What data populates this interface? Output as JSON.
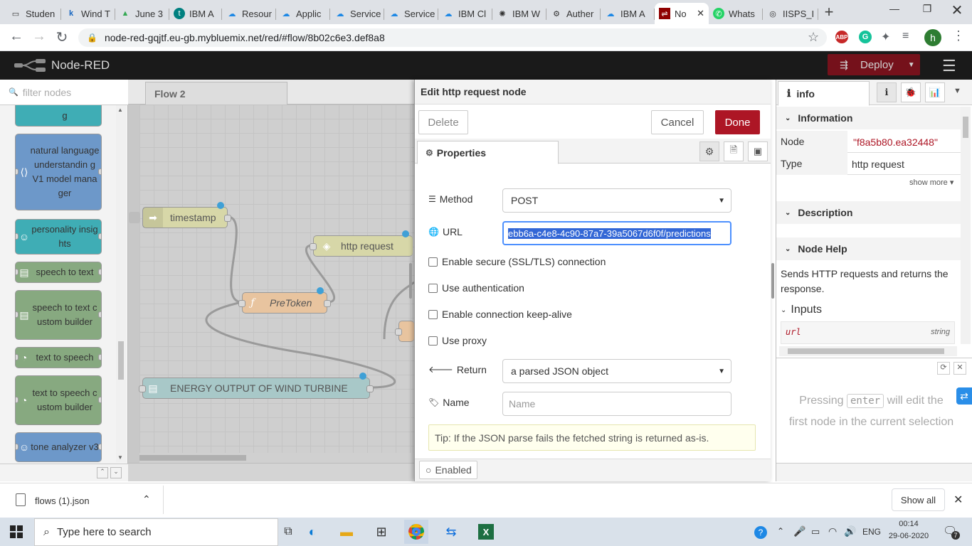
{
  "browser": {
    "tabs": [
      {
        "label": "Studen",
        "icon": "doc-icon"
      },
      {
        "label": "Wind T",
        "icon": "k-icon"
      },
      {
        "label": "June 3",
        "icon": "drive-icon"
      },
      {
        "label": "IBM A",
        "icon": "t-icon"
      },
      {
        "label": "Resour",
        "icon": "cloud-icon"
      },
      {
        "label": "Applic",
        "icon": "cloud-icon"
      },
      {
        "label": "Service",
        "icon": "cloud-icon"
      },
      {
        "label": "Service",
        "icon": "cloud-icon"
      },
      {
        "label": "IBM Cl",
        "icon": "cloud-icon"
      },
      {
        "label": "IBM W",
        "icon": "watson-icon"
      },
      {
        "label": "Auther",
        "icon": "auth-icon"
      },
      {
        "label": "IBM A",
        "icon": "cloud-icon"
      },
      {
        "label": "No",
        "icon": "nodered-icon",
        "active": true
      },
      {
        "label": "Whats",
        "icon": "whatsapp-icon"
      },
      {
        "label": "IISPS_I",
        "icon": "globe-icon"
      }
    ],
    "url": "node-red-gqjtf.eu-gb.mybluemix.net/red/#flow/8b02c6e3.def8a8",
    "profile_initial": "h",
    "new_tab": "+"
  },
  "nodered": {
    "app_title": "Node-RED",
    "deploy_label": "Deploy",
    "palette": {
      "filter_placeholder": "filter nodes",
      "nodes": [
        {
          "label": "g",
          "color": "#3FADB5"
        },
        {
          "label": "natural language understandin g V1 model manager",
          "color": "#6d98c9"
        },
        {
          "label": "personality insights",
          "color": "#3FADB5"
        },
        {
          "label": "speech to text",
          "color": "#87a980"
        },
        {
          "label": "speech to text custom builder",
          "color": "#87a980"
        },
        {
          "label": "text to speech",
          "color": "#87a980"
        },
        {
          "label": "text to speech custom builder",
          "color": "#87a980"
        },
        {
          "label": "tone analyzer v3",
          "color": "#6d98c9"
        }
      ]
    },
    "workspace": {
      "tab_label": "Flow 2",
      "nodes": {
        "timestamp": "timestamp",
        "http_request": "http request",
        "pretoken": "PreToken",
        "energy": "ENERGY OUTPUT OF WIND TURBINE"
      }
    },
    "editor": {
      "title": "Edit http request node",
      "delete_label": "Delete",
      "cancel_label": "Cancel",
      "done_label": "Done",
      "properties_tab": "Properties",
      "method_label": "Method",
      "method_value": "POST",
      "url_label": "URL",
      "url_value": "ebb6a-c4e8-4c90-87a7-39a5067d6f0f/predictions",
      "checkboxes": [
        "Enable secure (SSL/TLS) connection",
        "Use authentication",
        "Enable connection keep-alive",
        "Use proxy"
      ],
      "return_label": "Return",
      "return_value": "a parsed JSON object",
      "name_label": "Name",
      "name_placeholder": "Name",
      "tip": "Tip: If the JSON parse fails the fetched string is returned as-is.",
      "enabled_label": "Enabled"
    },
    "sidebar": {
      "tab_label": "info",
      "information_header": "Information",
      "node_key": "Node",
      "node_value": "\"f8a5b80.ea32448\"",
      "type_key": "Type",
      "type_value": "http request",
      "show_more": "show more",
      "description_header": "Description",
      "node_help_header": "Node Help",
      "help_text": "Sends HTTP requests and returns the response.",
      "inputs_header": "Inputs",
      "input_name": "url",
      "input_type": "string",
      "hint_pre": "Pressing",
      "hint_key": "enter",
      "hint_post": "will edit the",
      "hint_line2": "first node in the current selection"
    }
  },
  "downloads": {
    "file": "flows (1).json",
    "show_all": "Show all"
  },
  "taskbar": {
    "search_placeholder": "Type here to search",
    "lang": "ENG",
    "time": "00:14",
    "date": "29-06-2020",
    "notif_count": "7"
  },
  "colors": {
    "done_button": "#AD1625",
    "deploy_button": "#8C101C",
    "header_bg": "#1a1a1a",
    "selection": "#3367d6"
  }
}
